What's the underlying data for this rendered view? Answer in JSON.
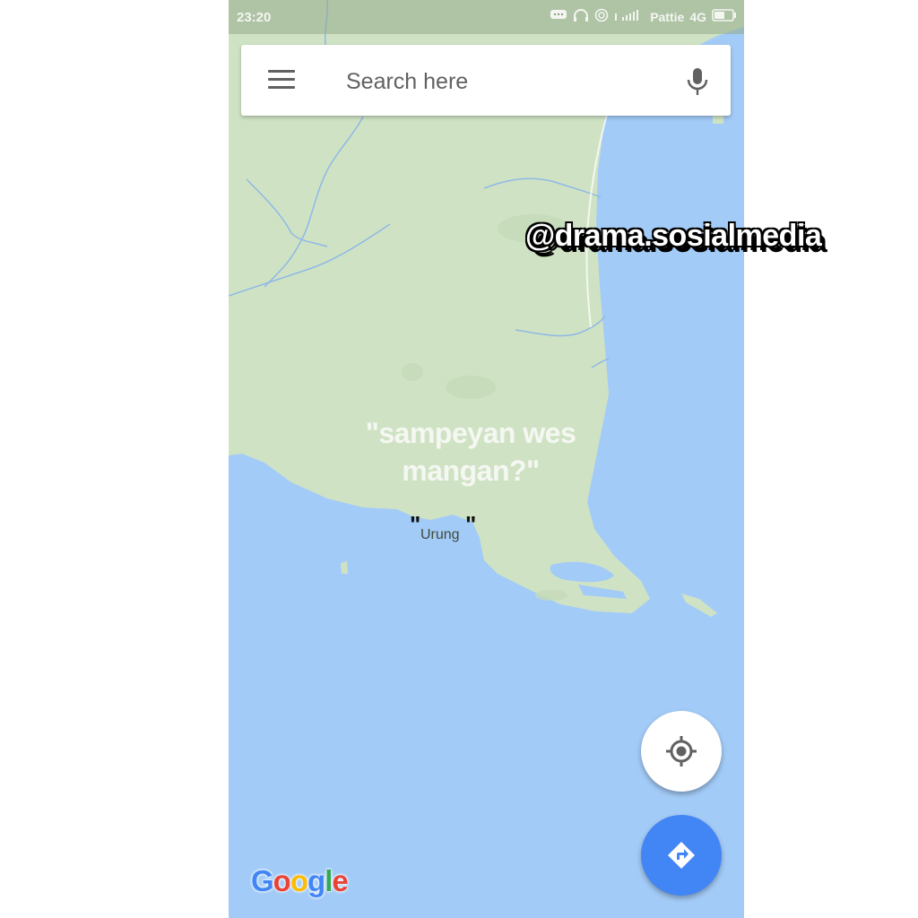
{
  "status_bar": {
    "time": "23:20",
    "carrier": "Pattie",
    "network": "4G",
    "icons": [
      "message-icon",
      "headphones-icon",
      "alarm-icon",
      "signal-icon",
      "battery-icon"
    ]
  },
  "search": {
    "placeholder": "Search here",
    "menu_icon": "hamburger-menu-icon",
    "mic_icon": "microphone-icon"
  },
  "map": {
    "caption_line1": "\"sampeyan wes",
    "caption_line2": "mangan?\"",
    "place_label": "Urung",
    "quote_left": "\"",
    "quote_right": "\"",
    "watermark": "@drama.sosialmedia",
    "logo": {
      "letters": [
        "G",
        "o",
        "o",
        "g",
        "l",
        "e"
      ],
      "colors": [
        "#4285f4",
        "#ea4335",
        "#fbbc05",
        "#4285f4",
        "#34a853",
        "#ea4335"
      ]
    }
  },
  "buttons": {
    "my_location_icon": "crosshair-icon",
    "directions_icon": "directions-arrow-icon"
  },
  "colors": {
    "land": "#cfe3c4",
    "water": "#a3cbf7",
    "accent": "#4285f4"
  }
}
